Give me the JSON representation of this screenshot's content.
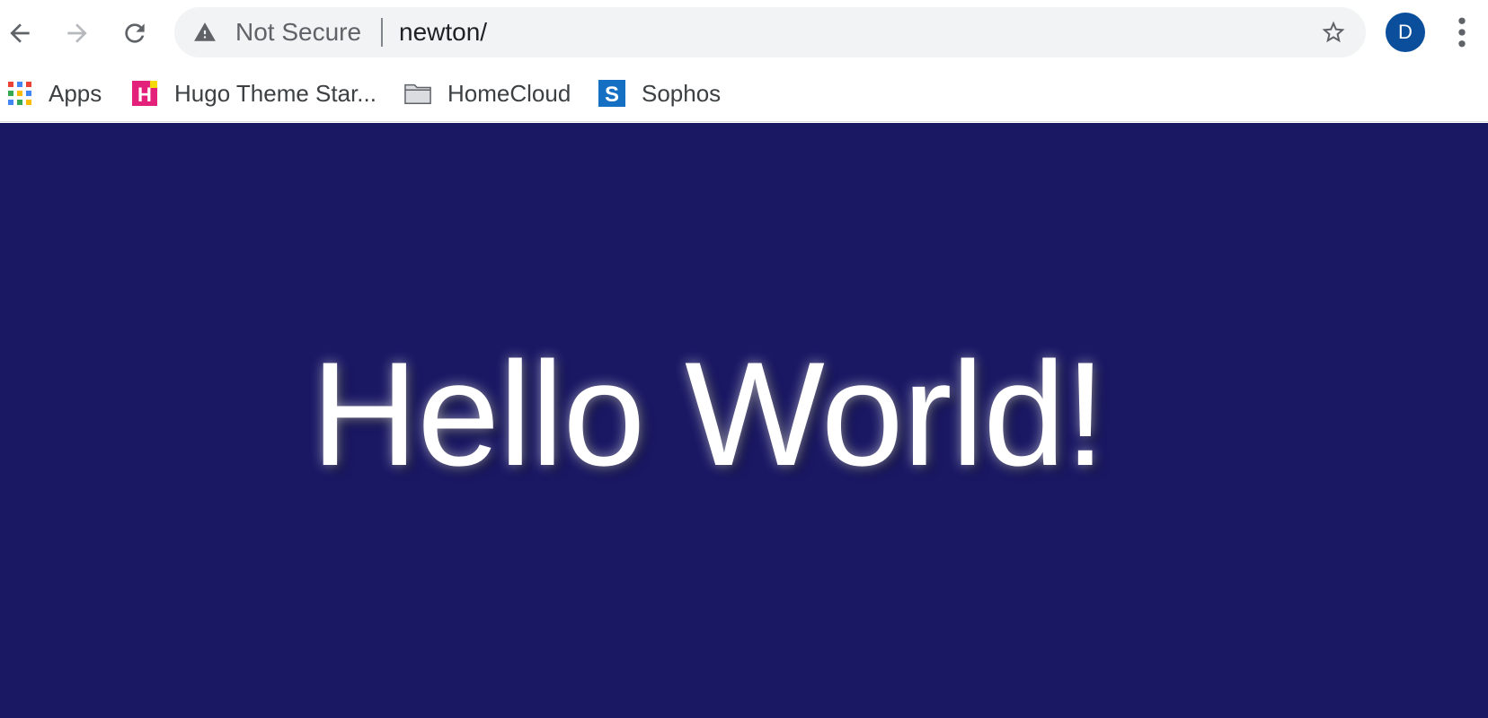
{
  "colors": {
    "page_background": "#1a1863",
    "avatar_background": "#0b4f9c",
    "hugo_pink": "#e4217a",
    "hugo_yellow": "#f5d90a",
    "sophos_blue": "#1570c4",
    "folder_gray": "#9aa0a6"
  },
  "toolbar": {
    "back_icon": "arrow-left-icon",
    "forward_icon": "arrow-right-icon",
    "reload_icon": "reload-icon",
    "menu_icon": "vertical-dots-icon"
  },
  "omnibox": {
    "security_icon": "warning-triangle-icon",
    "security_label": "Not Secure",
    "url": "newton/",
    "bookmark_icon": "star-outline-icon"
  },
  "profile": {
    "initial": "D"
  },
  "bookmarks": {
    "apps": {
      "label": "Apps",
      "icon": "apps-grid-icon"
    },
    "hugo": {
      "label": "Hugo Theme Star...",
      "icon": "hugo-logo-icon",
      "icon_letter": "H"
    },
    "homecloud": {
      "label": "HomeCloud",
      "icon": "folder-icon"
    },
    "sophos": {
      "label": "Sophos",
      "icon": "sophos-logo-icon",
      "icon_letter": "S"
    }
  },
  "page": {
    "heading": "Hello World!"
  }
}
